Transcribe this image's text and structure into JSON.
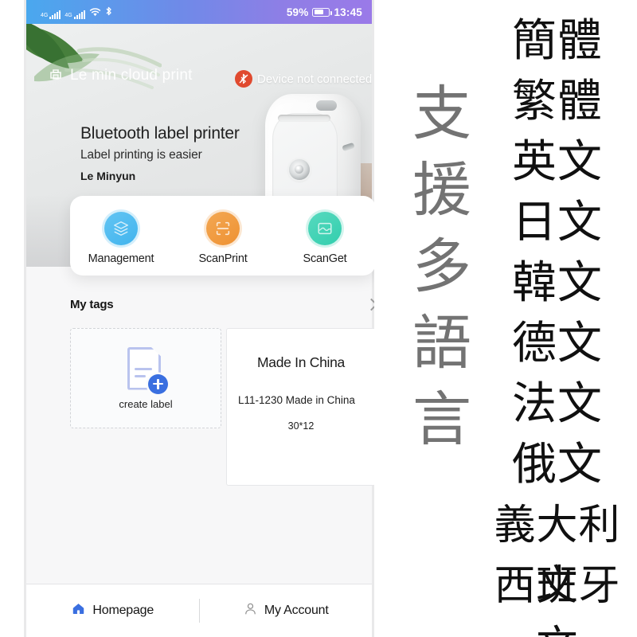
{
  "statusbar": {
    "network_1": "4G",
    "network_2": "4G",
    "wifi_icon": "wifi-icon",
    "bluetooth_icon": "bluetooth-icon",
    "battery_percent": "59%",
    "time": "13:45"
  },
  "hero": {
    "brand_icon": "cloud-printer-icon",
    "brand_name": "Le min cloud print",
    "connection_icon": "bluetooth-disconnected-icon",
    "connection_status": "Device not connected",
    "title": "Bluetooth label printer",
    "subtitle": "Label printing is easier",
    "vendor": "Le Minyun"
  },
  "actions": [
    {
      "label": "Management",
      "icon": "layers-icon",
      "color": "#42b4ee"
    },
    {
      "label": "ScanPrint",
      "icon": "scan-frame-icon",
      "color": "#ef9233"
    },
    {
      "label": "ScanGet",
      "icon": "inbox-tray-icon",
      "color": "#33cfae"
    }
  ],
  "tags_section": {
    "title": "My tags",
    "chevron_icon": "chevron-right-icon"
  },
  "tiles": {
    "create": {
      "icon": "document-add-icon",
      "label": "create label"
    },
    "label_item": {
      "preview_text": "Made In China",
      "name": "L11-1230 Made in China",
      "size": "30*12"
    }
  },
  "bottom_nav": [
    {
      "label": "Homepage",
      "icon": "home-icon",
      "active": true
    },
    {
      "label": "My Account",
      "icon": "person-icon",
      "active": false
    }
  ],
  "promo": {
    "vertical_text": [
      "支",
      "援",
      "多",
      "語",
      "言"
    ],
    "languages": [
      "簡體",
      "繁體",
      "英文",
      "日文",
      "韓文",
      "德文",
      "法文",
      "俄文",
      "義大利文",
      "西班牙文"
    ]
  },
  "colors": {
    "statusbar_start": "#4aa8ee",
    "statusbar_end": "#9a7ae8",
    "accent_blue": "#3a6fe0",
    "disconnect_red": "#e04a2f",
    "vertical_text_gray": "#737373"
  }
}
